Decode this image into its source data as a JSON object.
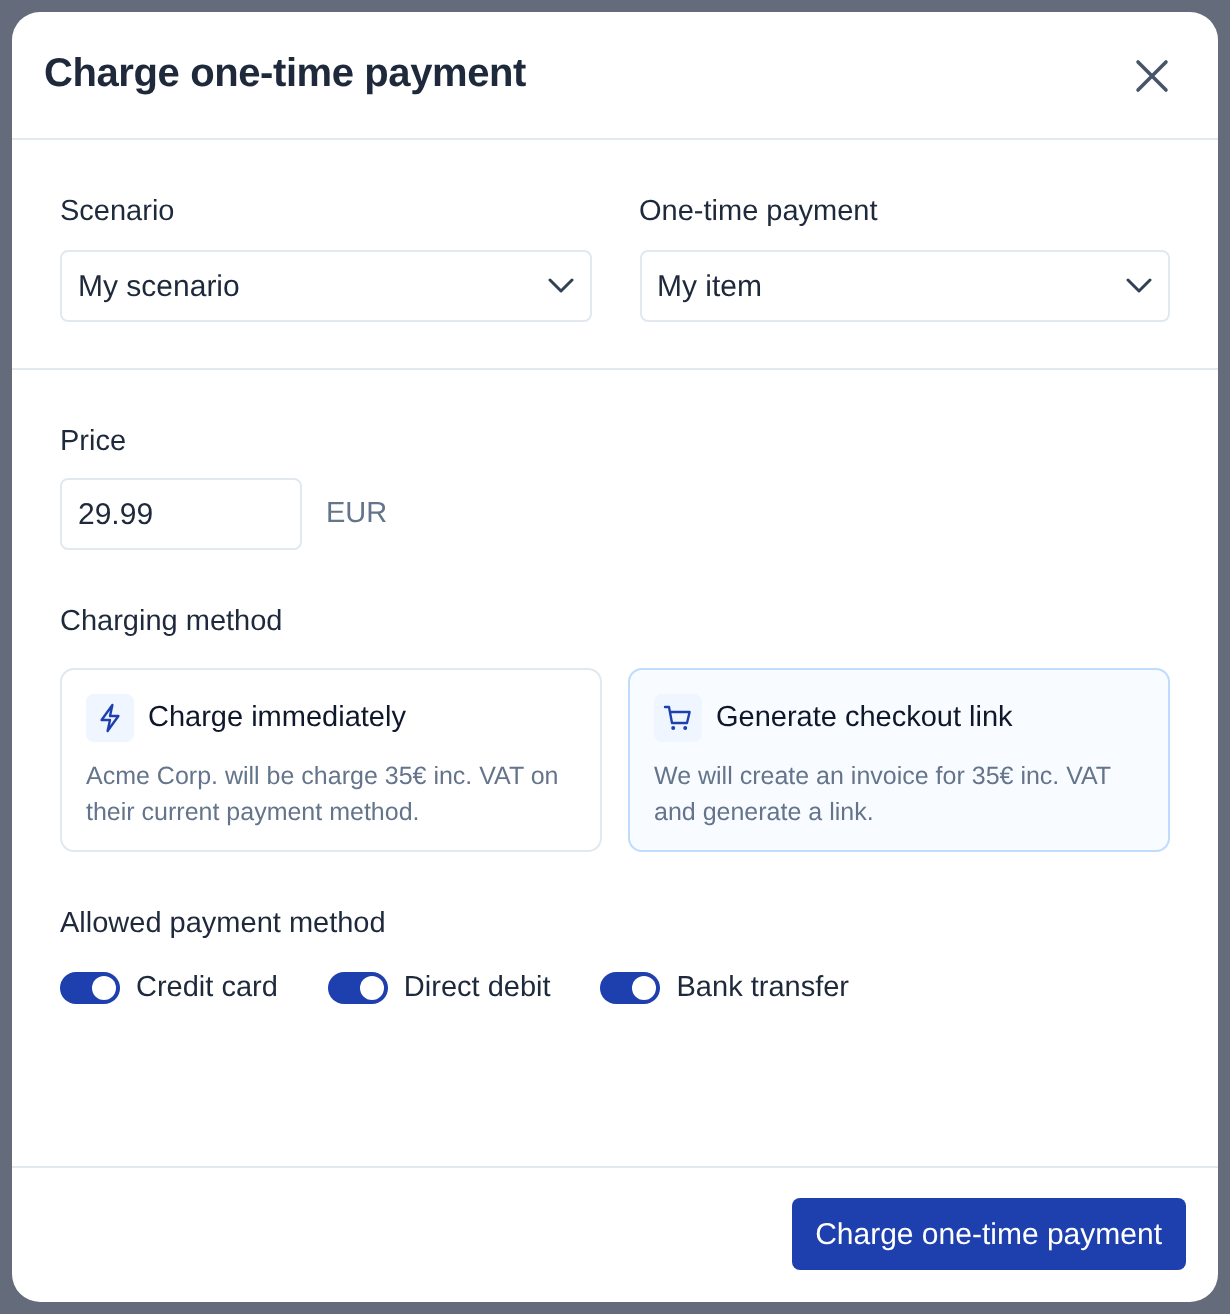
{
  "dialog": {
    "title": "Charge one-time payment"
  },
  "selects": [
    {
      "label": "Scenario",
      "value": "My scenario"
    },
    {
      "label": "One-time payment",
      "value": "My item"
    }
  ],
  "price": {
    "label": "Price",
    "value": "29.99",
    "currency": "EUR"
  },
  "charging_method": {
    "label": "Charging method",
    "options": [
      {
        "kind": "immediate",
        "title": "Charge immediately",
        "description": "Acme Corp. will be charge 35€ inc. VAT on their current payment method.",
        "selected": false
      },
      {
        "kind": "checkout",
        "title": "Generate checkout link",
        "description": "We will create an invoice for 35€ inc. VAT and generate a link.",
        "selected": true
      }
    ]
  },
  "allowed_payment_method": {
    "label": "Allowed payment method",
    "options": [
      {
        "label": "Credit card",
        "on": true
      },
      {
        "label": "Direct debit",
        "on": true
      },
      {
        "label": "Bank transfer",
        "on": true
      }
    ]
  },
  "footer": {
    "button": "Charge one-time payment"
  }
}
